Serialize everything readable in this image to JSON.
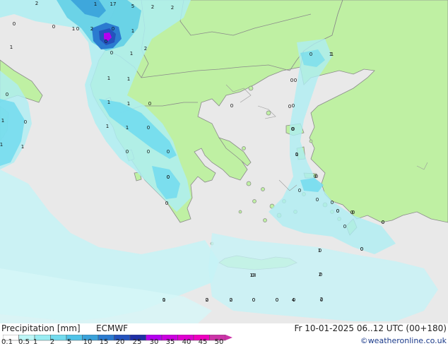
{
  "map": {
    "point_values": [
      "2",
      "0",
      "0",
      "1",
      "0",
      "1",
      "0",
      "1",
      "1",
      "1",
      "0",
      "0",
      "0",
      "0",
      "0",
      "0",
      "0",
      "0",
      "0",
      "0",
      "0",
      "0",
      "1",
      "2",
      "4",
      "2",
      "0",
      "0",
      "2",
      "2",
      "1",
      "18",
      "17",
      "5",
      "2",
      "2",
      "1",
      "2",
      "0",
      "1",
      "0",
      "1",
      "2",
      "1",
      "1",
      "1",
      "1",
      "0",
      "1",
      "1",
      "0",
      "0",
      "0",
      "0",
      "0",
      "0",
      "0",
      "0",
      "1",
      "0",
      "0",
      "0",
      "1",
      "0",
      "0",
      "0",
      "1",
      "0",
      "0",
      "0",
      "0",
      "0",
      "0",
      "0",
      "0",
      "0",
      "0",
      "0",
      "0",
      "0",
      "0",
      "0",
      "0"
    ],
    "colors": {
      "sea": "#e9e9e9",
      "land": "#bff0a3",
      "coast": "#9a9a9a",
      "border": "#8a8a8a"
    }
  },
  "footer": {
    "title": "Precipitation [mm]",
    "model": "ECMWF",
    "datetime": "Fr 10-01-2025 06..12 UTC (00+180)",
    "credit": "©weatheronline.co.uk"
  },
  "colorbar": {
    "labels": [
      "0.1",
      "0.5",
      "1",
      "2",
      "5",
      "10",
      "15",
      "20",
      "25",
      "30",
      "35",
      "40",
      "45",
      "50"
    ],
    "colors": [
      "#ffffff",
      "#bdf6f6",
      "#98ecf2",
      "#72dbee",
      "#4fc3e8",
      "#3aa2da",
      "#2b7bd0",
      "#2452bd",
      "#1f2fa6",
      "#b400f0",
      "#cc00e0",
      "#de00d0",
      "#ee00c0",
      "#cc33a8"
    ]
  }
}
